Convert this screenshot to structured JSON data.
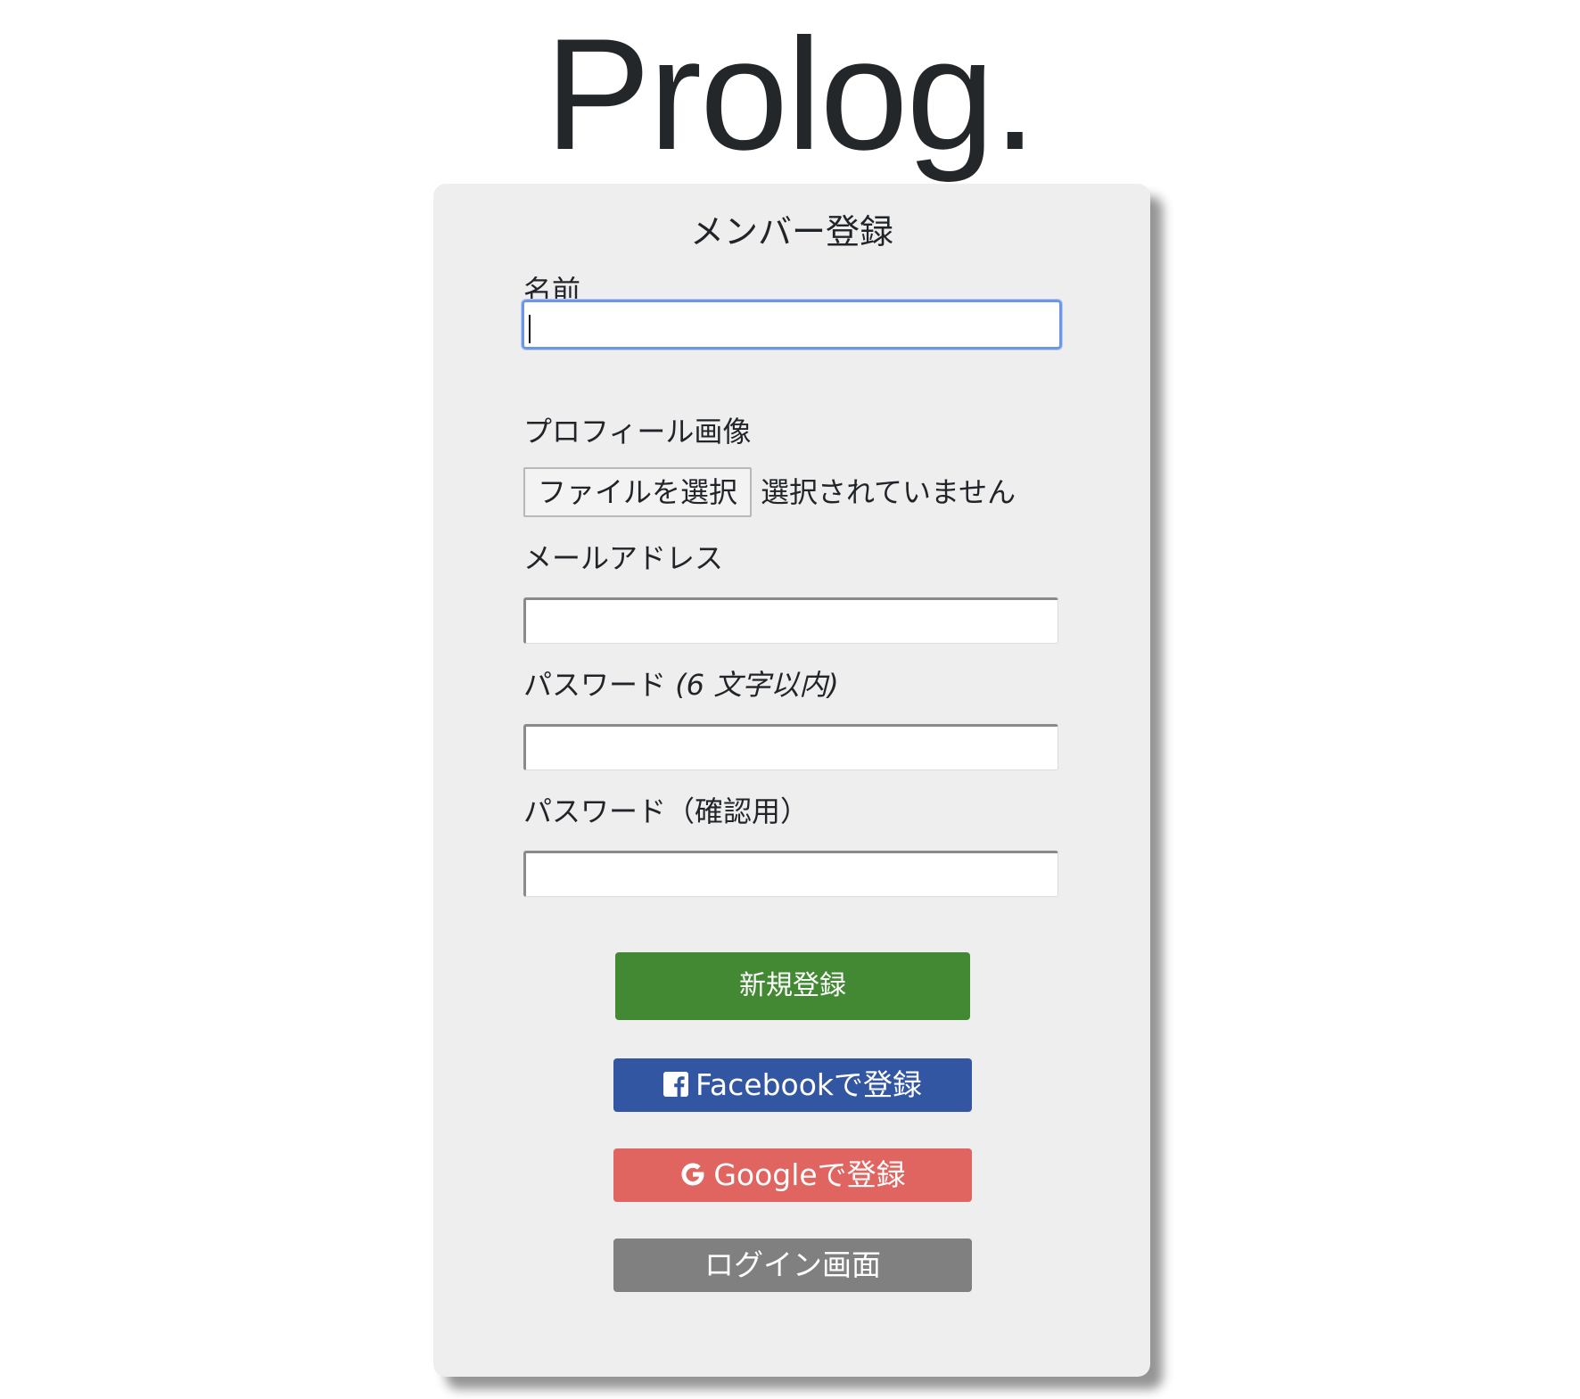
{
  "logo": {
    "text": "Prolog."
  },
  "form": {
    "title": "メンバー登録",
    "name_label": "名前",
    "name_value": "",
    "profile_image_label": "プロフィール画像",
    "file_button_label": "ファイルを選択",
    "file_status": "選択されていません",
    "email_label": "メールアドレス",
    "email_value": "",
    "password_label": "パスワード",
    "password_hint": "(6 文字以内)",
    "password_value": "",
    "password_confirm_label": "パスワード（確認用）",
    "password_confirm_value": ""
  },
  "buttons": {
    "register": "新規登録",
    "facebook": "Facebookで登録",
    "google": "Googleで登録",
    "login": "ログイン画面"
  },
  "icons": {
    "facebook": "facebook-icon",
    "google": "google-icon"
  },
  "colors": {
    "register_button": "#438832",
    "facebook_button": "#3356a3",
    "google_button": "#e06460",
    "login_button": "#808080",
    "card_background": "#eeeeee",
    "focus_ring": "#6f96e6"
  }
}
